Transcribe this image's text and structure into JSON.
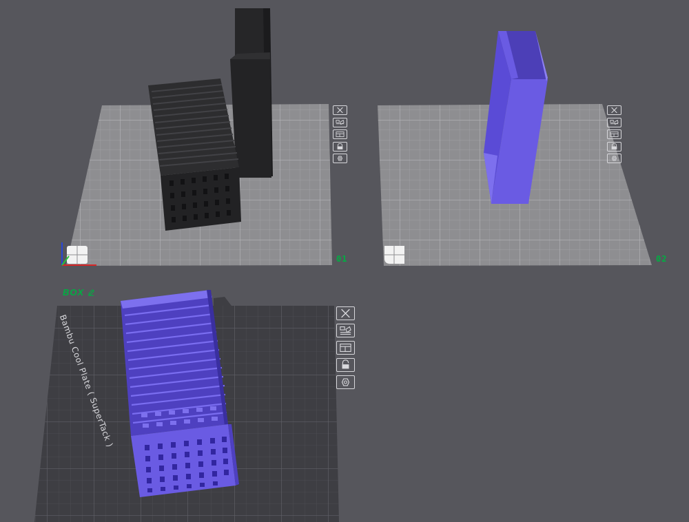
{
  "plates": [
    {
      "label": "01",
      "active": false,
      "model_color": "#2b2b2b"
    },
    {
      "label": "02",
      "active": false,
      "model_color": "#6a5be3"
    },
    {
      "label": "BOX",
      "active": true,
      "model_color": "#6a5be3",
      "plate_type": "Bambu Cool Plate ( SuperTack )"
    }
  ],
  "plate_toolbar": {
    "icons": [
      "close-icon",
      "arrange-icon",
      "orient-icon",
      "lock-icon",
      "settings-icon"
    ]
  },
  "colors": {
    "background": "#56565c",
    "inactive_plate": "#8e8e91",
    "active_plate": "#3e3e43",
    "label_green": "#00ae42",
    "model_purple": "#6a5be3",
    "model_black": "#2b2b2b"
  }
}
